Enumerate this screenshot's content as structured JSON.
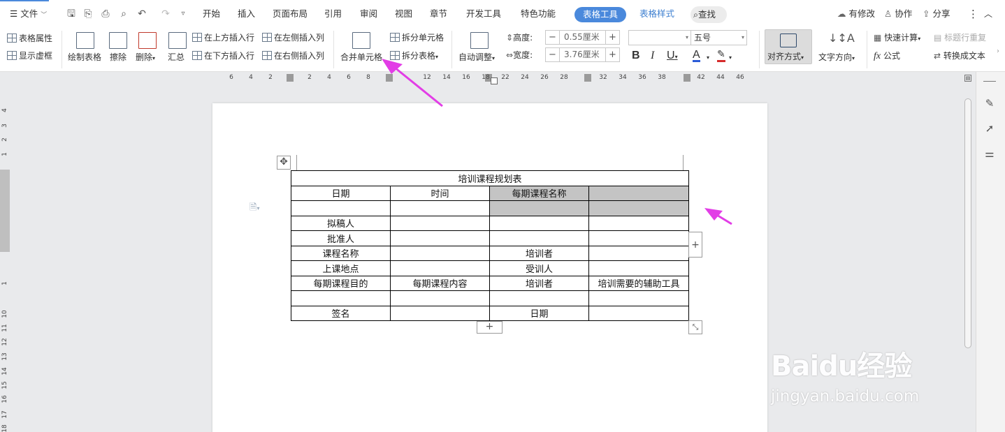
{
  "menu": {
    "file_label": "文件",
    "tabs": [
      "开始",
      "插入",
      "页面布局",
      "引用",
      "审阅",
      "视图",
      "章节",
      "开发工具",
      "特色功能"
    ],
    "active_tab": "表格工具",
    "extra_tab": "表格样式",
    "search_label": "查找",
    "right": [
      "有修改",
      "协作",
      "分享"
    ]
  },
  "ribbon": {
    "table_props": "表格属性",
    "show_grid": "显示虚框",
    "draw_table": "绘制表格",
    "erase": "擦除",
    "delete": "删除",
    "summary": "汇总",
    "insert_above": "在上方插入行",
    "insert_below": "在下方插入行",
    "insert_left": "在左侧插入列",
    "insert_right": "在右侧插入列",
    "merge_cells": "合并单元格",
    "split_cells": "拆分单元格",
    "split_table": "拆分表格",
    "auto_fit": "自动调整",
    "height_label": "高度:",
    "height_value": "0.55厘米",
    "width_label": "宽度:",
    "width_value": "3.76厘米",
    "font_size": "五号",
    "align": "对齐方式",
    "text_dir": "文字方向",
    "quick_calc": "快速计算",
    "repeat_header": "标题行重复",
    "formula": "公式",
    "to_text": "转换成文本"
  },
  "ruler_ticks": [
    "6",
    "4",
    "2",
    "2",
    "4",
    "6",
    "8",
    "12",
    "14",
    "16",
    "18",
    "22",
    "24",
    "26",
    "28",
    "32",
    "34",
    "36",
    "38",
    "42",
    "44",
    "46"
  ],
  "vruler_ticks": [
    "4",
    "3",
    "2",
    "1",
    "1",
    "10",
    "11",
    "12",
    "13",
    "14",
    "15",
    "16",
    "17",
    "18"
  ],
  "table": {
    "title": "培训课程规划表",
    "rows": [
      [
        "日期",
        "时间",
        "每期课程名称",
        ""
      ],
      [
        "",
        "",
        "",
        ""
      ],
      [
        "拟稿人",
        "",
        "",
        ""
      ],
      [
        "批准人",
        "",
        "",
        ""
      ],
      [
        "课程名称",
        "",
        "培训者",
        ""
      ],
      [
        "上课地点",
        "",
        "受训人",
        ""
      ],
      [
        "每期课程目的",
        "每期课程内容",
        "培训者",
        "培训需要的辅助工具"
      ],
      [
        "",
        "",
        "",
        ""
      ],
      [
        "签名",
        "",
        "日期",
        ""
      ]
    ]
  },
  "watermark": {
    "brand": "Baidu经验",
    "url": "jingyan.baidu.com"
  },
  "colors": {
    "accent": "#4a89dc",
    "arrow": "#e23de6",
    "selection": "#c4c4c4"
  }
}
